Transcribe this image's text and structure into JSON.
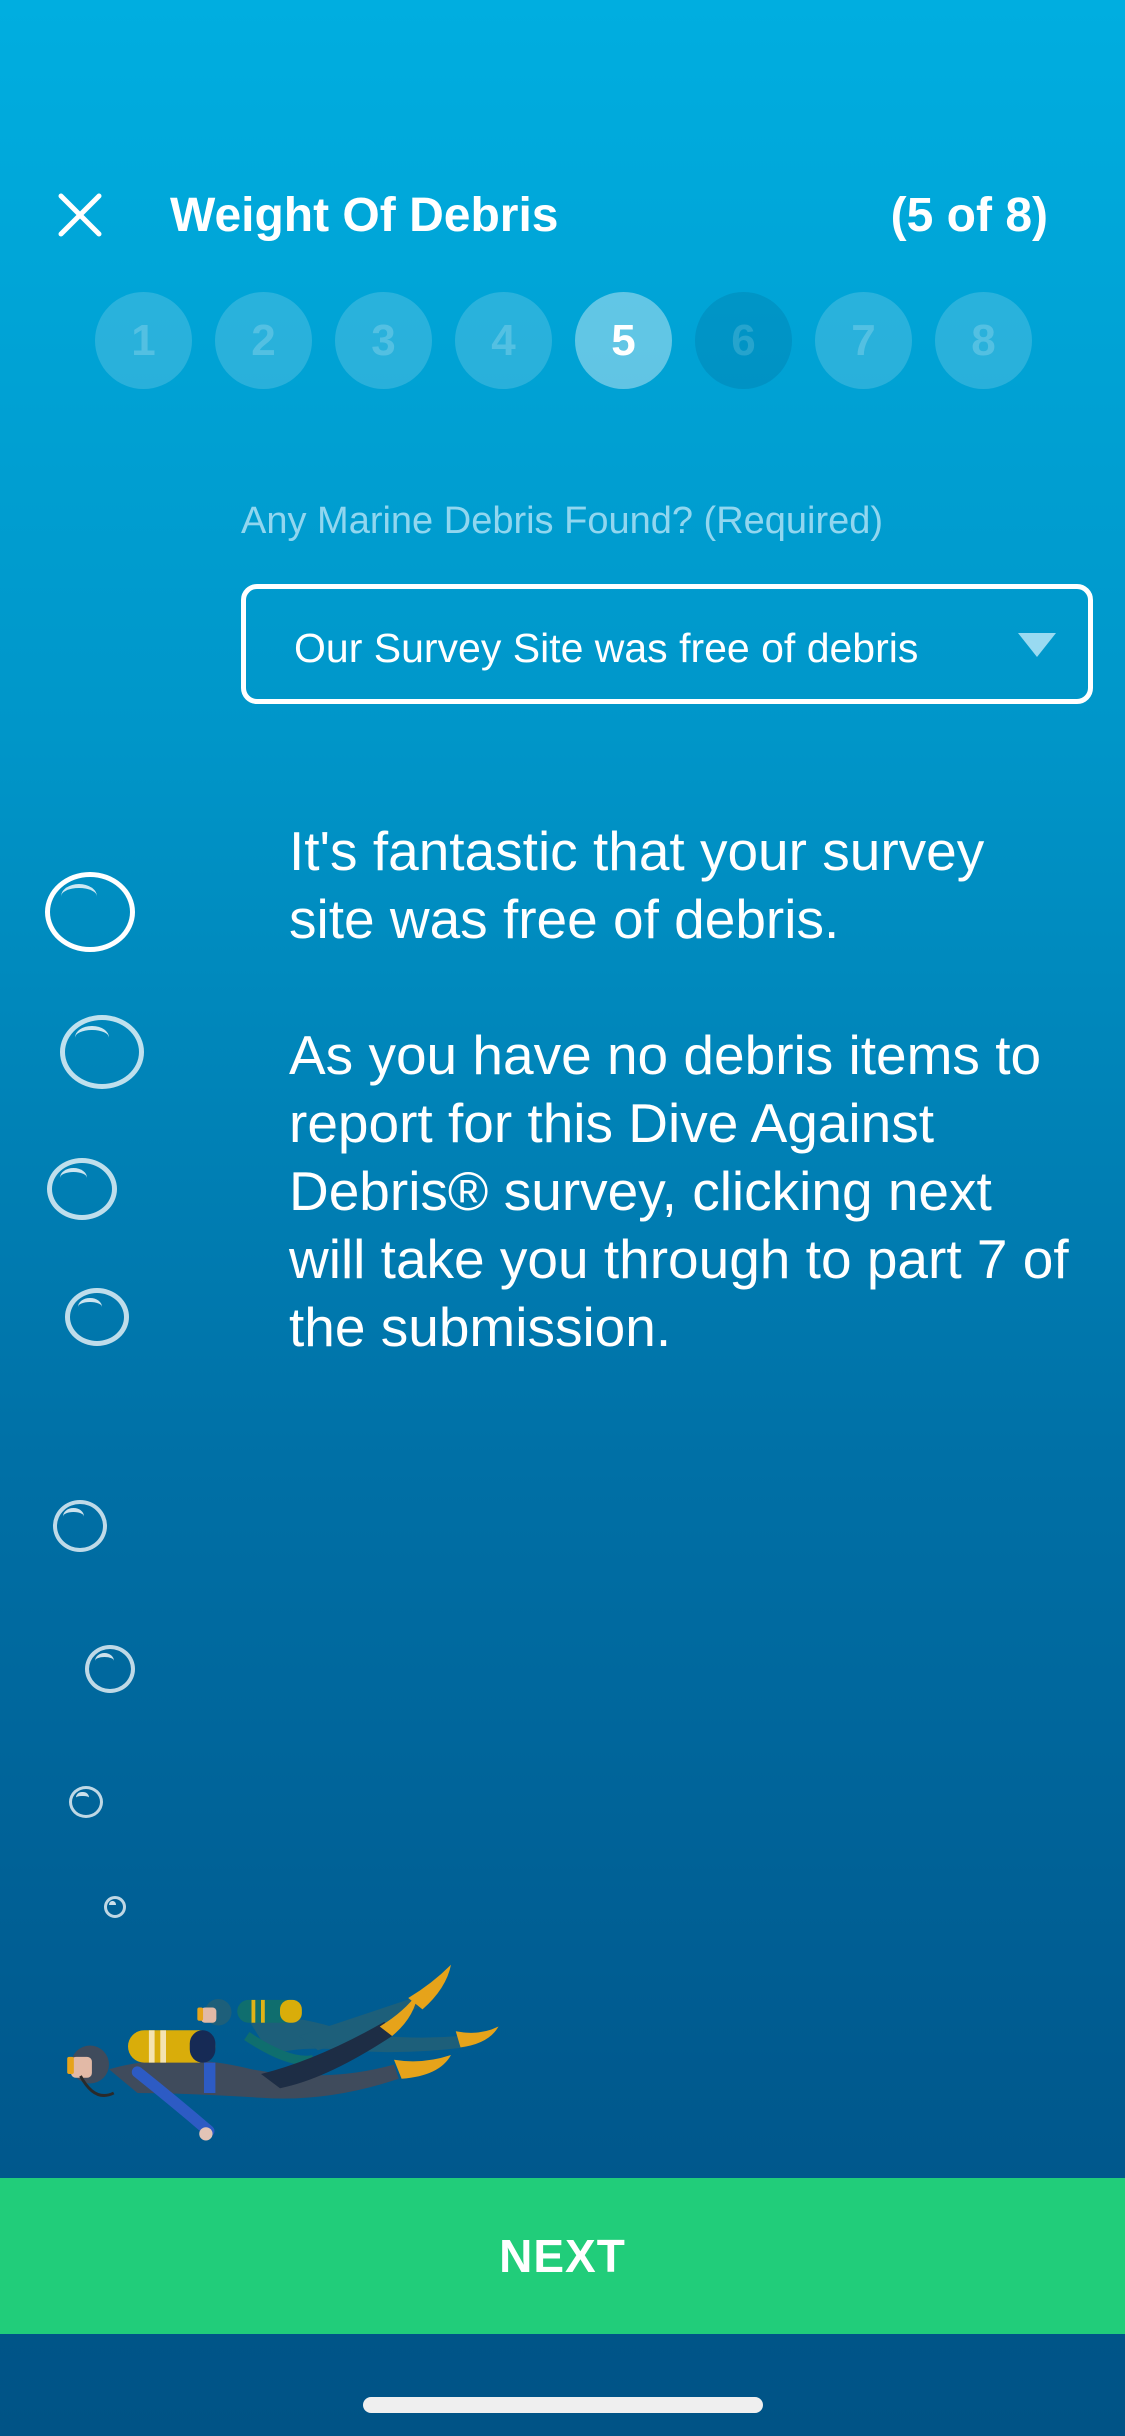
{
  "header": {
    "title": "Weight Of Debris",
    "step_count": "(5 of 8)",
    "close_icon": "close-icon"
  },
  "stepper": {
    "current": 5,
    "total": 8,
    "steps": [
      {
        "label": "1",
        "state": "inactive"
      },
      {
        "label": "2",
        "state": "inactive"
      },
      {
        "label": "3",
        "state": "inactive"
      },
      {
        "label": "4",
        "state": "inactive"
      },
      {
        "label": "5",
        "state": "active"
      },
      {
        "label": "6",
        "state": "disabled"
      },
      {
        "label": "7",
        "state": "inactive"
      },
      {
        "label": "8",
        "state": "inactive"
      }
    ]
  },
  "form": {
    "label": "Any Marine Debris Found? (Required)",
    "selected_value": "Our Survey Site was free of debris",
    "dropdown_icon": "triangle-down-icon"
  },
  "message": {
    "paragraph_1": "It's fantastic that your survey site was free of debris.",
    "paragraph_2": "As you have no debris items to report for this Dive Against Debris® survey, clicking next will take you through to part 7 of the submission."
  },
  "illustration": {
    "description": "scuba-divers-illustration",
    "bubbles_icon": "bubble-icon"
  },
  "footer": {
    "next_label": "NEXT"
  },
  "colors": {
    "background_top": "#00aee0",
    "background_bottom": "#005386",
    "next_button": "#21cd7a"
  }
}
